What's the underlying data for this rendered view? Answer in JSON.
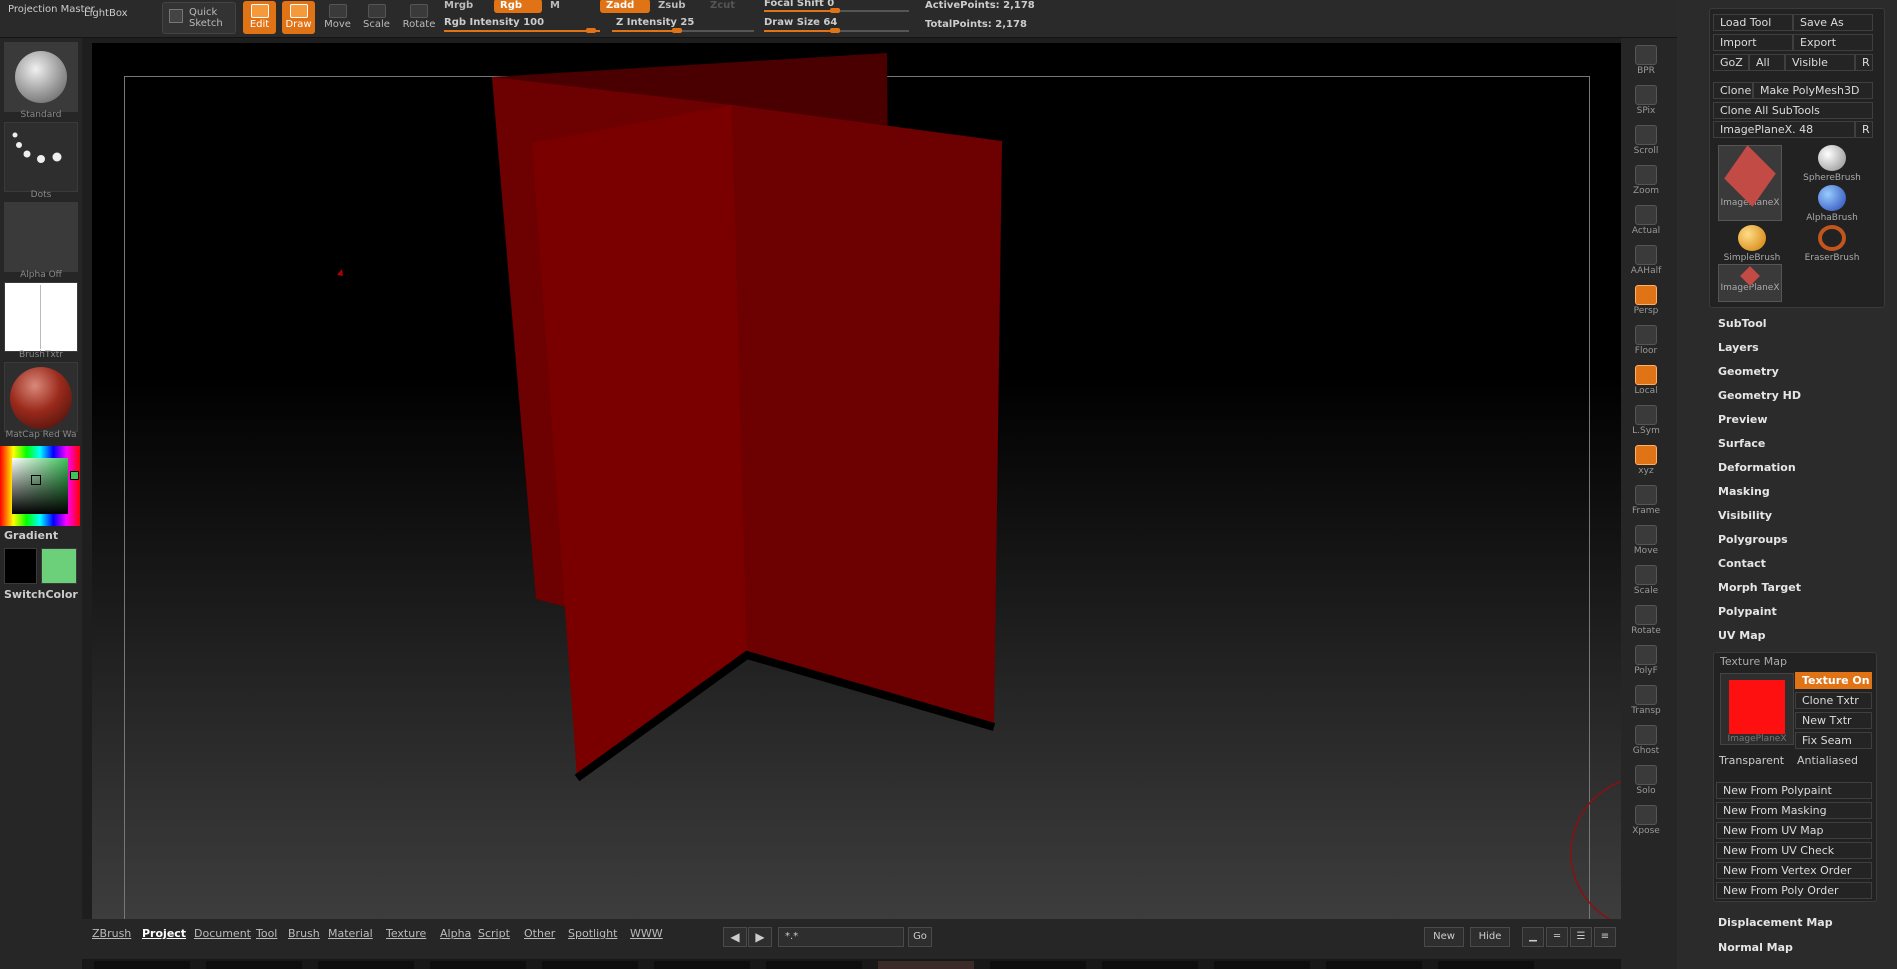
{
  "topbar": {
    "projection_master": "Projection Master",
    "lightbox": "LightBox",
    "quick_sketch": "Quick Sketch",
    "modes": [
      {
        "label": "Edit",
        "on": true
      },
      {
        "label": "Draw",
        "on": true
      },
      {
        "label": "Move",
        "on": false
      },
      {
        "label": "Scale",
        "on": false
      },
      {
        "label": "Rotate",
        "on": false
      }
    ],
    "mrgb": "Mrgb",
    "rgb": "Rgb",
    "m": "M",
    "zadd": "Zadd",
    "zsub": "Zsub",
    "zcut": "Zcut",
    "rgb_intensity_label": "Rgb Intensity",
    "rgb_intensity": "100",
    "z_intensity_label": "Z Intensity",
    "z_intensity": "25",
    "focal_shift_label": "Focal Shift",
    "focal_shift": "0",
    "draw_size_label": "Draw Size",
    "draw_size": "64",
    "active_points": "ActivePoints: 2,178",
    "total_points": "TotalPoints: 2,178"
  },
  "left": {
    "brush": "Standard",
    "stroke": "Dots",
    "alpha": "Alpha  Off",
    "texture": "BrushTxtr",
    "material": "MatCap  Red  Wa",
    "gradient": "Gradient",
    "switchcolor": "SwitchColor",
    "colors": {
      "main": "#000000",
      "secondary": "#6ccf7a"
    }
  },
  "rightshelf": [
    {
      "label": "BPR",
      "on": false
    },
    {
      "label": "SPix",
      "on": false
    },
    {
      "label": "Scroll",
      "on": false
    },
    {
      "label": "Zoom",
      "on": false
    },
    {
      "label": "Actual",
      "on": false
    },
    {
      "label": "AAHalf",
      "on": false
    },
    {
      "label": "Persp",
      "on": true
    },
    {
      "label": "Floor",
      "on": false
    },
    {
      "label": "Local",
      "on": true
    },
    {
      "label": "L.Sym",
      "on": false
    },
    {
      "label": "xyz",
      "on": true
    },
    {
      "label": "Frame",
      "on": false
    },
    {
      "label": "Move",
      "on": false
    },
    {
      "label": "Scale",
      "on": false
    },
    {
      "label": "Rotate",
      "on": false
    },
    {
      "label": "PolyF",
      "on": false
    },
    {
      "label": "Transp",
      "on": false
    },
    {
      "label": "Ghost",
      "on": false
    },
    {
      "label": "Solo",
      "on": false
    },
    {
      "label": "Xpose",
      "on": false
    }
  ],
  "tool": {
    "load_tool": "Load Tool",
    "save_as": "Save As",
    "import": "Import",
    "export": "Export",
    "goz": "GoZ",
    "all": "All",
    "visible": "Visible",
    "r": "R",
    "clone": "Clone",
    "make_polymesh": "Make PolyMesh3D",
    "clone_all": "Clone  All  SubTools",
    "imageplane_label": "ImagePlaneX.",
    "imageplane_value": "48",
    "tools": [
      "ImagePlaneX",
      "SphereBrush",
      "AlphaBrush",
      "SimpleBrush",
      "EraserBrush",
      "ImagePlaneX"
    ]
  },
  "menus": [
    "SubTool",
    "Layers",
    "Geometry",
    "Geometry HD",
    "Preview",
    "Surface",
    "Deformation",
    "Masking",
    "Visibility",
    "Polygroups",
    "Contact",
    "Morph Target",
    "Polypaint",
    "UV Map"
  ],
  "texture_map": {
    "title": "Texture Map",
    "thumb_caption": "ImagePlaneX",
    "texture_on": "Texture On",
    "clone_txtr": "Clone Txtr",
    "new_txtr": "New Txtr",
    "fix_seam": "Fix Seam",
    "transparent": "Transparent",
    "antialiased": "Antialiased",
    "new_from": [
      "New From Polypaint",
      "New From Masking",
      "New From UV Map",
      "New From UV Check",
      "New From Vertex Order",
      "New From Poly Order"
    ],
    "color": "#ff1010"
  },
  "menus_after": [
    "Displacement Map",
    "Normal Map"
  ],
  "bottom": {
    "menus": [
      "ZBrush",
      "Project",
      "Document",
      "Tool",
      "Brush",
      "Material",
      "Texture",
      "Alpha",
      "Script",
      "Other",
      "Spotlight",
      "WWW"
    ],
    "active": "Project",
    "search_value": "*.*",
    "go": "Go",
    "new": "New",
    "hide": "Hide"
  },
  "mesh_color": "#6d0000"
}
